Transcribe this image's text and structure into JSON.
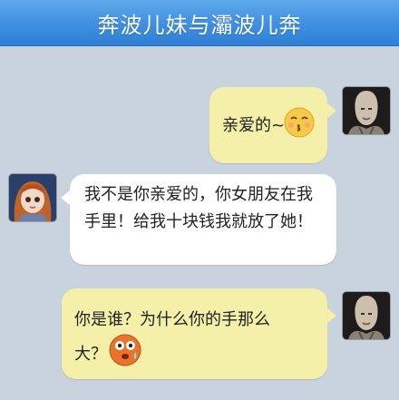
{
  "header": {
    "title": "奔波儿妹与灞波儿奔"
  },
  "messages": [
    {
      "sender": "me",
      "avatar_icon": "bald-man-avatar",
      "text": "亲爱的~",
      "emoji": "kiss-face-emoji"
    },
    {
      "sender": "them",
      "avatar_icon": "doll-girl-avatar",
      "text": "我不是你亲爱的，你女朋友在我手里！给我十块钱我就放了她！"
    },
    {
      "sender": "me",
      "avatar_icon": "bald-man-avatar",
      "text_line1": "你是谁？为什么你的手那么",
      "text_line2": "大？",
      "emoji": "shocked-face-emoji"
    }
  ],
  "colors": {
    "header": "#3e8fe0",
    "background": "#c9d3dd",
    "my_bubble": "#f5f0a9",
    "their_bubble": "#ffffff"
  }
}
